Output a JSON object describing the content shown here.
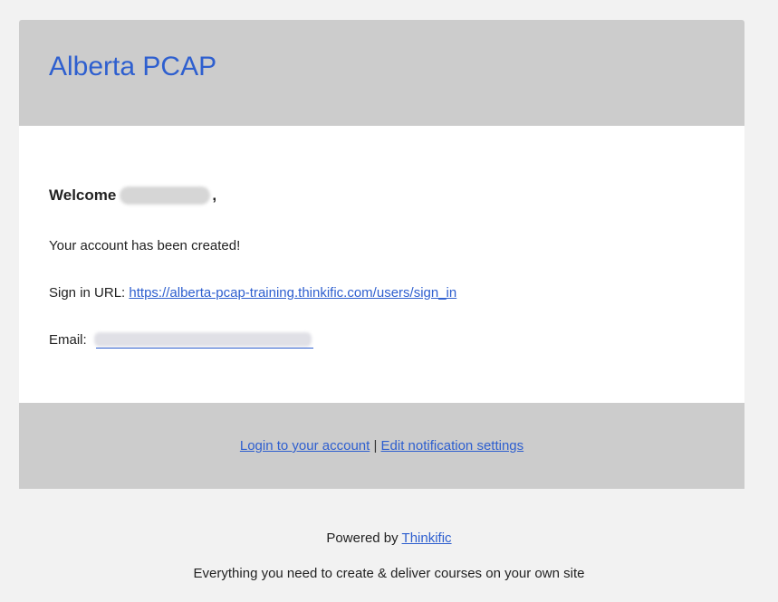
{
  "header": {
    "brand": "Alberta PCAP"
  },
  "content": {
    "welcome_prefix": "Welcome",
    "welcome_suffix": ",",
    "account_created": "Your account has been created!",
    "signin_label": "Sign in URL:",
    "signin_url": "https://alberta-pcap-training.thinkific.com/users/sign_in",
    "email_label": "Email:"
  },
  "footer": {
    "login_link": "Login to your account",
    "separator": "|",
    "settings_link": "Edit notification settings"
  },
  "bottom": {
    "powered_prefix": "Powered by",
    "powered_link": "Thinkific",
    "tagline": "Everything you need to create & deliver courses on your own site"
  },
  "colors": {
    "page_background": "#f2f2f2",
    "header_background": "#cccccc",
    "link": "#2e5fcf",
    "brand": "#2e5fcf"
  }
}
